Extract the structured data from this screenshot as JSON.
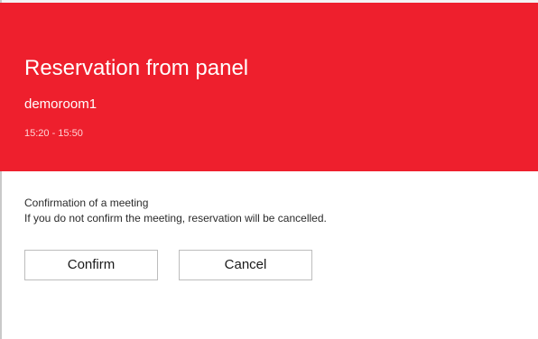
{
  "header": {
    "title": "Reservation from panel",
    "room": "demoroom1",
    "time": "15:20 - 15:50",
    "color": "#ee1f2d"
  },
  "message": {
    "line1": "Confirmation of a meeting",
    "line2": "If you do not confirm the meeting, reservation will be cancelled."
  },
  "buttons": {
    "confirm_label": "Confirm",
    "cancel_label": "Cancel"
  }
}
